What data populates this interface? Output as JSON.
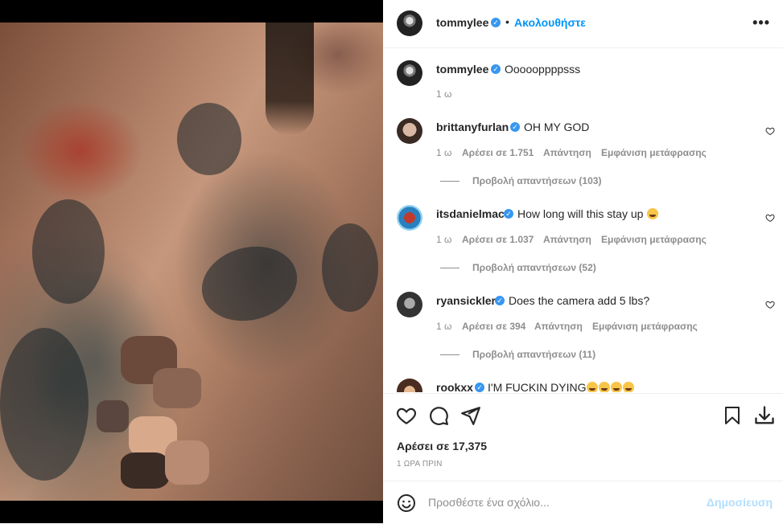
{
  "post": {
    "author": "tommylee",
    "follow_label": "Ακολουθήστε",
    "dot": "•",
    "more_label": "•••",
    "caption_user": "tommylee",
    "caption_text": "Oooooppppsss",
    "caption_time": "1 ω"
  },
  "comments": [
    {
      "user": "brittanyfurlan",
      "text": "OH MY GOD",
      "time": "1 ω",
      "likes": "Αρέσει σε 1.751",
      "reply": "Απάντηση",
      "translate": "Εμφάνιση μετάφρασης",
      "view_replies": "Προβολή απαντήσεων (103)"
    },
    {
      "user": "itsdanielmac",
      "text": "How long will this stay up",
      "time": "1 ω",
      "likes": "Αρέσει σε 1.037",
      "reply": "Απάντηση",
      "translate": "Εμφάνιση μετάφρασης",
      "view_replies": "Προβολή απαντήσεων (52)"
    },
    {
      "user": "ryansickler",
      "text": "Does the camera add 5 lbs?",
      "time": "1 ω",
      "likes": "Αρέσει σε 394",
      "reply": "Απάντηση",
      "translate": "Εμφάνιση μετάφρασης",
      "view_replies": "Προβολή απαντήσεων (11)"
    },
    {
      "user": "rookxx",
      "text": "I'M FUCKIN DYING"
    }
  ],
  "footer": {
    "likes": "Αρέσει σε 17,375",
    "time": "1 ΩΡΑ ΠΡΙΝ",
    "comment_placeholder": "Προσθέστε ένα σχόλιο...",
    "post_label": "Δημοσίευση"
  },
  "colors": {
    "accent": "#0095f6",
    "verified": "#3897f0",
    "muted": "#8e8e8e",
    "post_disabled": "#b2dffc"
  },
  "icons": [
    "verified-badge-icon",
    "more-options-icon",
    "heart-icon",
    "comment-icon",
    "share-icon",
    "save-icon",
    "download-icon",
    "emoji-icon"
  ]
}
